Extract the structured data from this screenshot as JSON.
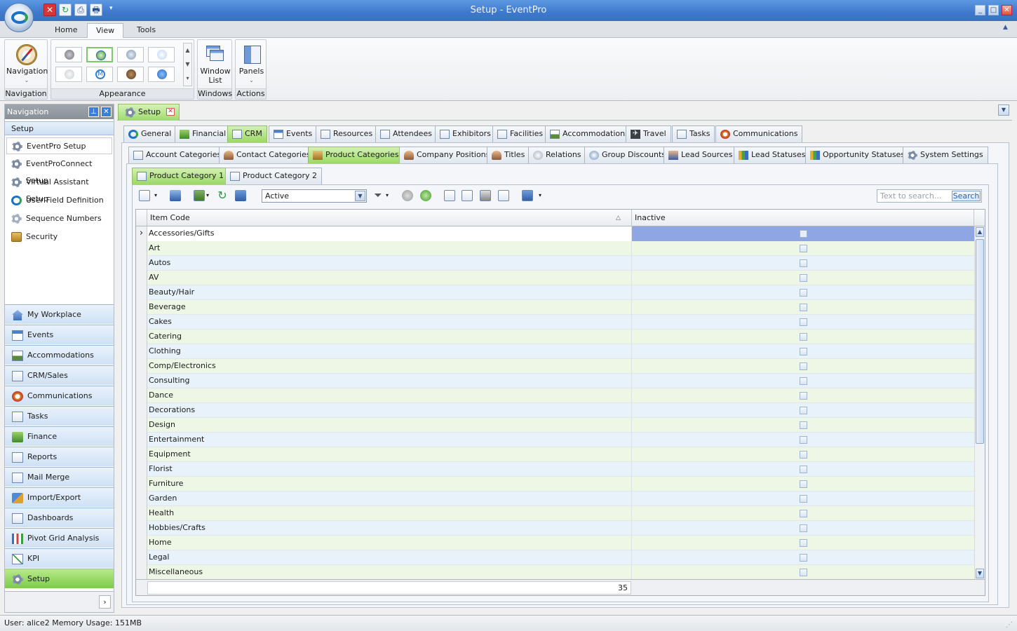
{
  "window": {
    "title": "Setup - EventPro"
  },
  "ribbon": {
    "tabs": [
      "Home",
      "View",
      "Tools"
    ],
    "groups": {
      "navigation": {
        "label": "Navigation",
        "button": "Navigation"
      },
      "appearance": {
        "label": "Appearance"
      },
      "windows": {
        "label": "Windows",
        "button": "Window List"
      },
      "actions": {
        "label": "Actions",
        "button": "Panels"
      }
    }
  },
  "nav": {
    "header": "Navigation",
    "group": "Setup",
    "items": [
      "EventPro Setup",
      "EventProConnect Setup",
      "Virtual Assistant Setup",
      "User Field Definition",
      "Sequence Numbers",
      "Security"
    ],
    "modules": [
      "My Workplace",
      "Events",
      "Accommodations",
      "CRM/Sales",
      "Communications",
      "Tasks",
      "Finance",
      "Reports",
      "Mail Merge",
      "Import/Export",
      "Dashboards",
      "Pivot Grid Analysis",
      "KPI",
      "Setup"
    ]
  },
  "doc_tab": "Setup",
  "main_tabs": [
    "General",
    "Financial",
    "CRM",
    "Events",
    "Resources",
    "Attendees",
    "Exhibitors",
    "Facilities",
    "Accommodations",
    "Travel",
    "Tasks",
    "Communications"
  ],
  "crm_tabs": [
    "Account Categories",
    "Contact Categories",
    "Product Categories",
    "Company Positions",
    "Titles",
    "Relations",
    "Group Discounts",
    "Lead Sources",
    "Lead Statuses",
    "Opportunity Statuses",
    "System Settings"
  ],
  "product_tabs": [
    "Product Category 1",
    "Product Category 2"
  ],
  "toolbar": {
    "filter_value": "Active",
    "search_placeholder": "Text to search...",
    "search_button": "Search"
  },
  "grid": {
    "columns": [
      "Item Code",
      "Inactive"
    ],
    "rows": [
      "Accessories/Gifts",
      "Art",
      "Autos",
      "AV",
      "Beauty/Hair",
      "Beverage",
      "Cakes",
      "Catering",
      "Clothing",
      "Comp/Electronics",
      "Consulting",
      "Dance",
      "Decorations",
      "Design",
      "Entertainment",
      "Equipment",
      "Florist",
      "Furniture",
      "Garden",
      "Health",
      "Hobbies/Crafts",
      "Home",
      "Legal",
      "Miscellaneous"
    ],
    "count": "35"
  },
  "status": {
    "text": "User: alice2  Memory Usage: 151MB"
  },
  "colors": {
    "title_bar": "#3e78cc",
    "active_tab": "#9bd864",
    "selected_row": "#8ea6e3"
  }
}
